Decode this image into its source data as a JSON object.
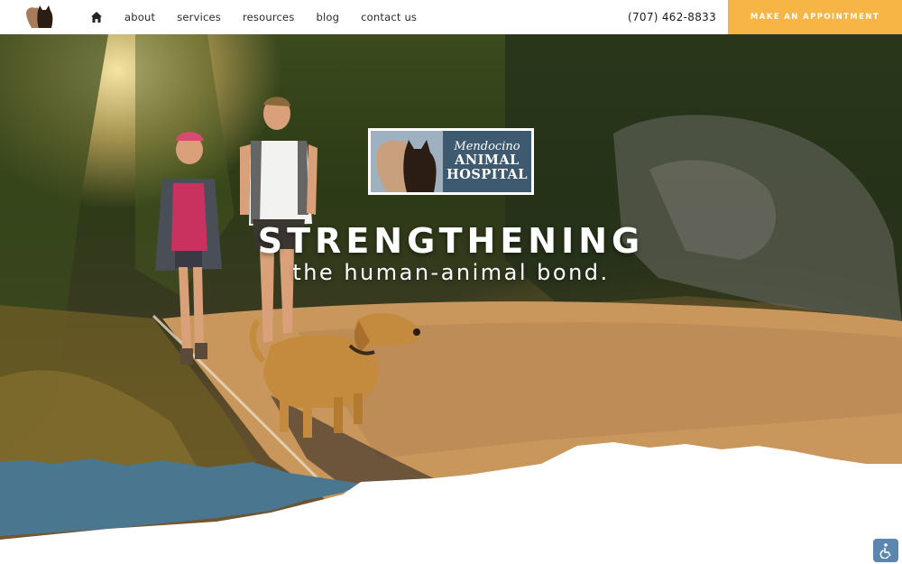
{
  "header": {
    "logo_icon": "dog-and-cat-silhouette-icon",
    "home_icon": "home-icon",
    "nav": [
      "about",
      "services",
      "resources",
      "blog",
      "contact us"
    ],
    "phone": "(707) 462-8833",
    "cta_label": "MAKE AN APPOINTMENT"
  },
  "hero": {
    "logo": {
      "line1": "Mendocino",
      "line2": "ANIMAL",
      "line3": "HOSPITAL"
    },
    "headline": "STRENGTHENING",
    "subheadline": "the human-animal bond."
  },
  "accessibility": {
    "icon": "wheelchair-accessibility-icon"
  },
  "colors": {
    "accent": "#f6b545",
    "torn_blue": "#4a7690",
    "logo_panel": "#3e5a70",
    "text_dark": "#2a2a2a"
  }
}
